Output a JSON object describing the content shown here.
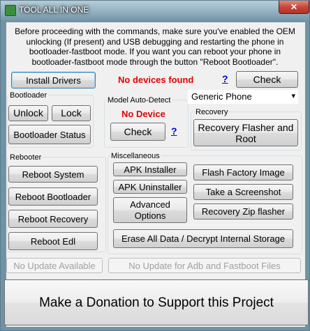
{
  "window": {
    "title": "TOOL ALL IN ONE",
    "close_label": "✕"
  },
  "intro_text": "Before proceeding with the commands, make sure you've enabled the OEM unlocking (If present) and USB debugging and restarting the phone in bootloader-fastboot mode. If you want you can reboot your phone in bootloader-fastboot mode through the button \"Reboot Bootloader\".",
  "top_row": {
    "install_drivers": "Install Drivers",
    "device_status": "No devices found",
    "help": "?",
    "check": "Check"
  },
  "bootloader": {
    "label": "Bootloader",
    "unlock": "Unlock",
    "lock": "Lock",
    "status": "Bootloader Status"
  },
  "model_detect": {
    "label": "Model Auto-Detect",
    "status": "No Device",
    "check": "Check",
    "help": "?"
  },
  "phone_select": {
    "value": "Generic Phone",
    "arrow": "▾"
  },
  "recovery": {
    "label": "Recovery",
    "flasher": "Recovery Flasher and Root"
  },
  "rebooter": {
    "label": "Rebooter",
    "system": "Reboot System",
    "bootloader": "Reboot Bootloader",
    "recovery": "Reboot Recovery",
    "edl": "Reboot Edl"
  },
  "misc": {
    "label": "Miscellaneous",
    "apk_installer": "APK Installer",
    "apk_uninstaller": "APK Uninstaller",
    "advanced": "Advanced Options",
    "flash_factory": "Flash Factory Image",
    "screenshot": "Take a Screenshot",
    "zip_flasher": "Recovery Zip flasher",
    "erase": "Erase All Data / Decrypt Internal Storage"
  },
  "updates": {
    "app": "No Update Available",
    "adb": "No Update for Adb and Fastboot Files"
  },
  "donation": "Make a Donation to Support this Project",
  "colors": {
    "status_red": "#e00000",
    "help_blue": "#0000d0"
  }
}
